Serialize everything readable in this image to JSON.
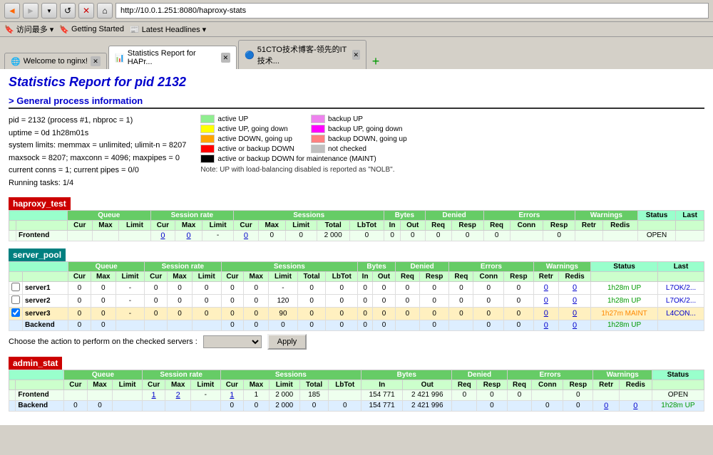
{
  "browser": {
    "address": "http://10.0.1.251:8080/haproxy-stats",
    "back_icon": "◄",
    "forward_icon": "►",
    "reload_icon": "↺",
    "stop_icon": "✕",
    "home_icon": "⌂",
    "tabs": [
      {
        "label": "Welcome to nginx!",
        "active": false,
        "favicon": "🌐"
      },
      {
        "label": "Statistics Report for HAPr...",
        "active": true,
        "favicon": "📊"
      },
      {
        "label": "51CTO技术博客-领先的IT技术...",
        "active": false,
        "favicon": "🔵"
      }
    ],
    "bookmarks": [
      "访问最多 ▾",
      "Getting Started",
      "Latest Headlines ▾"
    ]
  },
  "page": {
    "title": "Statistics Report for pid 2132",
    "section1_header": "> General process information",
    "process_info": {
      "line1": "pid = 2132 (process #1, nbproc = 1)",
      "line2": "uptime = 0d 1h28m01s",
      "line3": "system limits: memmax = unlimited; ulimit-n = 8207",
      "line4": "maxsock = 8207; maxconn = 4096; maxpipes = 0",
      "line5": "current conns = 1; current pipes = 0/0",
      "line6": "Running tasks: 1/4"
    },
    "legend": [
      {
        "color": "#90ee90",
        "label": "active UP"
      },
      {
        "color": "#ee82ee",
        "label": "backup UP"
      },
      {
        "color": "#ffff00",
        "label": "active UP, going down"
      },
      {
        "color": "#ff00ff",
        "label": "backup UP, going down"
      },
      {
        "color": "#ffa500",
        "label": "active DOWN, going up"
      },
      {
        "color": "#ff8080",
        "label": "backup DOWN, going up"
      },
      {
        "color": "#ff0000",
        "label": "active or backup DOWN"
      },
      {
        "color": "#c0c0c0",
        "label": "not checked"
      },
      {
        "color": "#000000",
        "label": "active or backup DOWN for maintenance (MAINT)",
        "wide": true
      }
    ],
    "legend_note": "Note: UP with load-balancing disabled is reported as \"NOLB\".",
    "haproxy_section": {
      "name": "haproxy_test",
      "color": "#cc0000",
      "col_groups": [
        "Queue",
        "Session rate",
        "Sessions",
        "Bytes",
        "Denied",
        "Errors",
        "Warnings",
        "Status",
        "Last"
      ],
      "col_subs": {
        "Queue": [
          "Cur",
          "Max",
          "Limit"
        ],
        "Session rate": [
          "Cur",
          "Max",
          "Limit"
        ],
        "Sessions": [
          "Cur",
          "Max",
          "Limit",
          "Total",
          "LbTot"
        ],
        "Bytes": [
          "In",
          "Out"
        ],
        "Denied": [
          "Req",
          "Resp"
        ],
        "Errors": [
          "Req",
          "Conn",
          "Resp"
        ],
        "Warnings": [
          "Retr",
          "Redis"
        ],
        "Status": [],
        "Last": []
      },
      "rows": [
        {
          "type": "frontend",
          "label": "Frontend",
          "checkbox": false,
          "queue_cur": "",
          "queue_max": "",
          "queue_limit": "",
          "sr_cur": "0",
          "sr_max": "0",
          "sr_limit": "-",
          "s_cur": "0",
          "s_max": "0",
          "s_limit": "0",
          "s_total": "2 000",
          "s_lbtot": "0",
          "b_in": "0",
          "b_out": "0",
          "d_req": "0",
          "d_resp": "0",
          "e_req": "0",
          "e_conn": "",
          "e_resp": "0",
          "w_retr": "",
          "w_redis": "",
          "status": "OPEN",
          "last": ""
        }
      ]
    },
    "server_pool_section": {
      "name": "server_pool",
      "color": "#008080",
      "rows": [
        {
          "type": "server",
          "label": "server1",
          "checkbox": true,
          "checked": false,
          "queue_cur": "0",
          "queue_max": "0",
          "queue_limit": "-",
          "sr_cur": "0",
          "sr_max": "0",
          "sr_limit": "0",
          "s_cur": "0",
          "s_max": "0",
          "s_limit": "-",
          "s_total": "0",
          "s_lbtot": "0",
          "b_in": "0",
          "b_out": "0",
          "d_req": "0",
          "d_resp": "0",
          "e_req": "0",
          "e_conn": "0",
          "e_resp": "0",
          "w_retr": "0",
          "w_redis": "0",
          "status": "1h28m UP",
          "status_type": "up",
          "last": "L7OK/2..."
        },
        {
          "type": "server",
          "label": "server2",
          "checkbox": true,
          "checked": false,
          "queue_cur": "0",
          "queue_max": "0",
          "queue_limit": "-",
          "sr_cur": "0",
          "sr_max": "0",
          "sr_limit": "0",
          "s_cur": "0",
          "s_max": "0",
          "s_limit": "120",
          "s_total": "0",
          "s_lbtot": "0",
          "b_in": "0",
          "b_out": "0",
          "d_req": "0",
          "d_resp": "0",
          "e_req": "0",
          "e_conn": "0",
          "e_resp": "0",
          "w_retr": "0",
          "w_redis": "0",
          "status": "1h28m UP",
          "status_type": "up",
          "last": "L7OK/2..."
        },
        {
          "type": "server maint",
          "label": "server3",
          "checkbox": true,
          "checked": true,
          "queue_cur": "0",
          "queue_max": "0",
          "queue_limit": "-",
          "sr_cur": "0",
          "sr_max": "0",
          "sr_limit": "0",
          "s_cur": "0",
          "s_max": "0",
          "s_limit": "90",
          "s_total": "0",
          "s_lbtot": "0",
          "b_in": "0",
          "b_out": "0",
          "d_req": "0",
          "d_resp": "0",
          "e_req": "0",
          "e_conn": "0",
          "e_resp": "0",
          "w_retr": "0",
          "w_redis": "0",
          "status": "1h27m MAINT",
          "status_type": "maint",
          "last": "L4CON..."
        },
        {
          "type": "backend",
          "label": "Backend",
          "checkbox": false,
          "queue_cur": "0",
          "queue_max": "0",
          "queue_limit": "",
          "sr_cur": "",
          "sr_max": "",
          "sr_limit": "",
          "s_cur": "0",
          "s_max": "0",
          "s_limit": "0",
          "s_total": "0",
          "s_lbtot": "0",
          "b_in": "0",
          "b_out": "0",
          "d_req": "",
          "d_resp": "0",
          "e_req": "",
          "e_conn": "0",
          "e_resp": "0",
          "w_retr": "0",
          "w_redis": "0",
          "status": "1h28m UP",
          "status_type": "up",
          "last": ""
        }
      ]
    },
    "action_row": {
      "label": "Choose the action to perform on the checked servers :",
      "select_placeholder": "▾",
      "apply_label": "Apply"
    },
    "admin_stat_section": {
      "name": "admin_stat",
      "color": "#cc0000",
      "rows": [
        {
          "type": "frontend",
          "label": "Frontend",
          "queue_cur": "",
          "queue_max": "",
          "queue_limit": "",
          "sr_cur": "1",
          "sr_max": "2",
          "sr_limit": "-",
          "s_cur": "1",
          "s_max": "1",
          "s_limit": "2 000",
          "s_total": "185",
          "s_lbtot": "",
          "b_in": "154 771",
          "b_out": "2 421 996",
          "d_req": "0",
          "d_resp": "0",
          "e_req": "0",
          "e_conn": "",
          "e_resp": "0",
          "w_retr": "",
          "w_redis": "",
          "status": "OPEN",
          "last": ""
        },
        {
          "type": "backend",
          "label": "Backend",
          "queue_cur": "0",
          "queue_max": "0",
          "queue_limit": "",
          "sr_cur": "",
          "sr_max": "",
          "sr_limit": "",
          "s_cur": "0",
          "s_max": "0",
          "s_limit": "2 000",
          "s_total": "0",
          "s_lbtot": "0",
          "b_in": "154 771",
          "b_out": "2 421 996",
          "d_req": "",
          "d_resp": "0",
          "e_req": "",
          "e_conn": "0",
          "e_resp": "0",
          "w_retr": "0",
          "w_redis": "0",
          "status": "1h28m UP",
          "status_type": "up",
          "last": ""
        }
      ]
    }
  }
}
